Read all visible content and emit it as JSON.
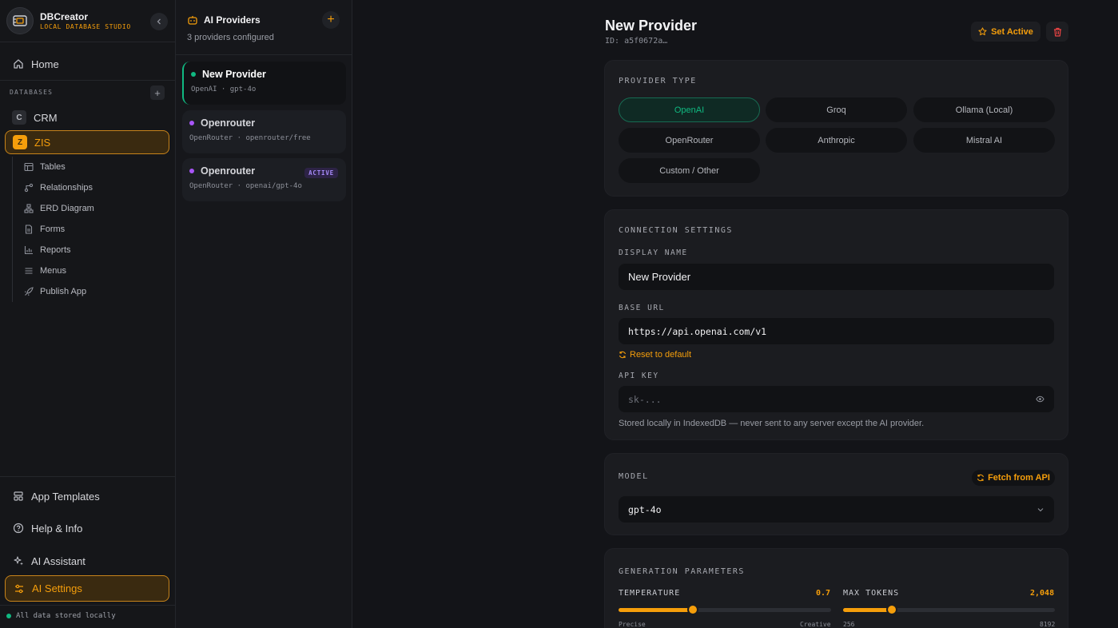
{
  "app": {
    "name": "DBCreator",
    "subtitle": "LOCAL DATABASE STUDIO"
  },
  "sidebar": {
    "home_label": "Home",
    "databases_label": "DATABASES",
    "add_db_symbol": "+",
    "databases": [
      {
        "initial": "C",
        "name": "CRM"
      },
      {
        "initial": "Z",
        "name": "ZIS",
        "active": true
      }
    ],
    "sub_items": [
      {
        "label": "Tables",
        "icon": "table-icon"
      },
      {
        "label": "Relationships",
        "icon": "relationships-icon"
      },
      {
        "label": "ERD Diagram",
        "icon": "diagram-icon"
      },
      {
        "label": "Forms",
        "icon": "form-icon"
      },
      {
        "label": "Reports",
        "icon": "chart-icon"
      },
      {
        "label": "Menus",
        "icon": "menu-icon"
      },
      {
        "label": "Publish App",
        "icon": "rocket-icon"
      }
    ],
    "bottom_items": [
      {
        "label": "App Templates",
        "icon": "templates-icon"
      },
      {
        "label": "Help & Info",
        "icon": "help-icon"
      },
      {
        "label": "AI Assistant",
        "icon": "sparkles-icon"
      },
      {
        "label": "AI Settings",
        "icon": "settings-sliders-icon",
        "active": true
      }
    ],
    "footer_status": "All data stored locally"
  },
  "providers_panel": {
    "title": "AI Providers",
    "subtitle": "3 providers configured",
    "add_symbol": "+",
    "providers": [
      {
        "name": "New Provider",
        "meta": "OpenAI · gpt-4o",
        "dot_color": "#10b981",
        "selected": true
      },
      {
        "name": "Openrouter",
        "meta": "OpenRouter · openrouter/free",
        "dot_color": "#a855f7"
      },
      {
        "name": "Openrouter",
        "meta": "OpenRouter · openai/gpt-4o",
        "dot_color": "#a855f7",
        "tag": "ACTIVE"
      }
    ]
  },
  "detail": {
    "title": "New Provider",
    "id_text": "ID: a5f0672a…",
    "set_active_label": "Set Active",
    "provider_type": {
      "label": "PROVIDER TYPE",
      "options": [
        "OpenAI",
        "Groq",
        "Ollama (Local)",
        "OpenRouter",
        "Anthropic",
        "Mistral AI",
        "Custom / Other"
      ],
      "selected": "OpenAI"
    },
    "connection": {
      "label": "CONNECTION SETTINGS",
      "display_name_label": "DISPLAY NAME",
      "display_name_value": "New Provider",
      "base_url_label": "BASE URL",
      "base_url_value": "https://api.openai.com/v1",
      "reset_label": "Reset to default",
      "api_key_label": "API KEY",
      "api_key_placeholder": "sk-...",
      "hint": "Stored locally in IndexedDB — never sent to any server except the AI provider."
    },
    "model": {
      "label": "MODEL",
      "fetch_label": "Fetch from API",
      "selected": "gpt-4o"
    },
    "generation": {
      "label": "GENERATION PARAMETERS",
      "temperature": {
        "label": "TEMPERATURE",
        "value": 0.7,
        "display": "0.7",
        "min_label": "Precise",
        "max_label": "Creative",
        "fraction": 0.35
      },
      "max_tokens": {
        "label": "MAX TOKENS",
        "value": 2048,
        "display": "2,048",
        "min_label": "256",
        "max_label": "8192",
        "fraction": 0.23
      }
    }
  },
  "colors": {
    "accent": "#f59e0b",
    "success": "#10b981",
    "purple": "#a855f7",
    "danger": "#ef4444"
  }
}
